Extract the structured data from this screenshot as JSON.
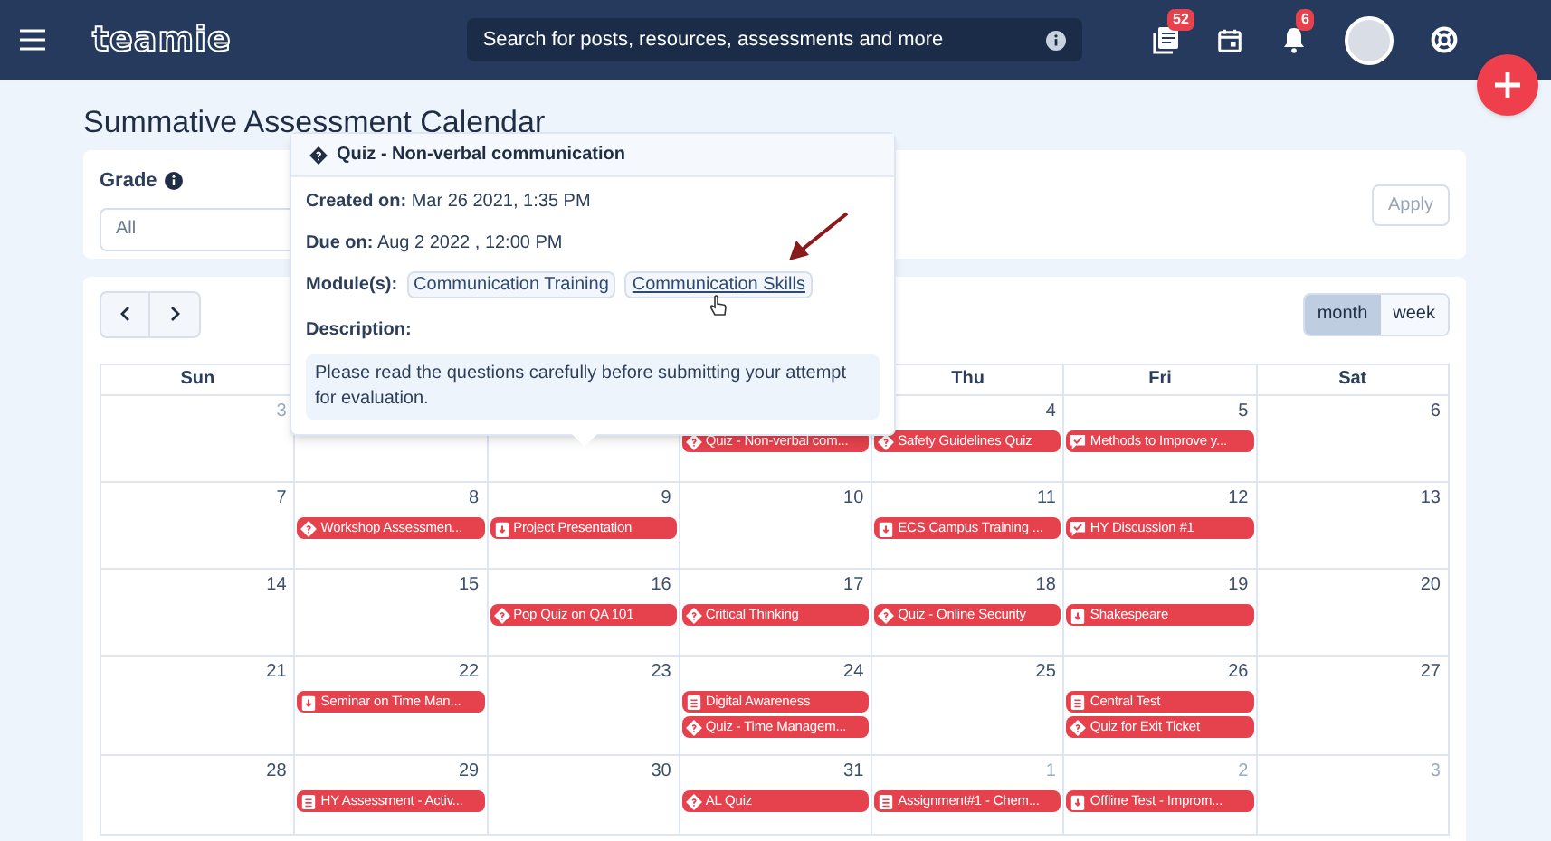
{
  "navbar": {
    "logo": "teamie",
    "search": {
      "placeholder": "Search for posts, resources, assessments and more"
    },
    "badges": [
      {
        "kind": "posts",
        "count": "52"
      },
      {
        "kind": "calendar"
      },
      {
        "kind": "notifications",
        "count": "6"
      }
    ]
  },
  "page_title": "Summative Assessment Calendar",
  "filter": {
    "label": "Grade",
    "select_value": "All",
    "apply": {
      "label": "Apply",
      "disabled": true
    }
  },
  "views": [
    {
      "label": "month",
      "selected": true
    },
    {
      "label": "week",
      "selected": false
    }
  ],
  "weekdays": {
    "left": [
      "Sun"
    ],
    "right": [
      "Thu",
      "Fri",
      "Sat"
    ]
  },
  "weeks": [
    {
      "days_left": [
        {
          "day": "3",
          "muted": true
        }
      ],
      "days_right": [
        {
          "events": [
            {
              "kind": "quiz",
              "title": "Quiz - Non-verbal com..."
            }
          ]
        },
        {
          "day": "4",
          "muted": false,
          "events": [
            {
              "kind": "quiz",
              "title": "Safety Guidelines Quiz"
            }
          ]
        },
        {
          "day": "5",
          "muted": false,
          "events": [
            {
              "kind": "discussion",
              "title": "Methods to Improve y..."
            }
          ]
        },
        {
          "day": "6",
          "muted": false
        }
      ]
    },
    {
      "days": [
        {
          "day": "7",
          "muted": false
        },
        {
          "day": "8",
          "muted": false,
          "events": [
            {
              "kind": "quiz",
              "title": "Workshop Assessmen..."
            }
          ]
        },
        {
          "day": "9",
          "muted": false,
          "events": [
            {
              "kind": "submission",
              "title": "Project Presentation"
            }
          ]
        },
        {
          "day": "10",
          "muted": false
        },
        {
          "day": "11",
          "muted": false,
          "events": [
            {
              "kind": "submission",
              "title": "ECS Campus Training ..."
            }
          ]
        },
        {
          "day": "12",
          "muted": false,
          "events": [
            {
              "kind": "discussion",
              "title": "HY Discussion #1"
            }
          ]
        },
        {
          "day": "13",
          "muted": false
        }
      ]
    },
    {
      "days": [
        {
          "day": "14",
          "muted": false
        },
        {
          "day": "15",
          "muted": false
        },
        {
          "day": "16",
          "muted": false,
          "events": [
            {
              "kind": "quiz",
              "title": "Pop Quiz on QA 101"
            }
          ]
        },
        {
          "day": "17",
          "muted": false,
          "events": [
            {
              "kind": "quiz",
              "title": "Critical Thinking"
            }
          ]
        },
        {
          "day": "18",
          "muted": false,
          "events": [
            {
              "kind": "quiz",
              "title": "Quiz - Online Security"
            }
          ]
        },
        {
          "day": "19",
          "muted": false,
          "events": [
            {
              "kind": "submission",
              "title": "Shakespeare"
            }
          ]
        },
        {
          "day": "20",
          "muted": false
        }
      ]
    },
    {
      "days": [
        {
          "day": "21",
          "muted": false
        },
        {
          "day": "22",
          "muted": false,
          "events": [
            {
              "kind": "submission",
              "title": "Seminar on Time Man..."
            }
          ]
        },
        {
          "day": "23",
          "muted": false
        },
        {
          "day": "24",
          "muted": false,
          "events": [
            {
              "kind": "document",
              "title": "Digital Awareness"
            },
            {
              "kind": "quiz",
              "title": "Quiz - Time Managem..."
            }
          ]
        },
        {
          "day": "25",
          "muted": false
        },
        {
          "day": "26",
          "muted": false,
          "events": [
            {
              "kind": "document",
              "title": "Central Test"
            },
            {
              "kind": "quiz",
              "title": "Quiz for Exit Ticket"
            }
          ]
        },
        {
          "day": "27",
          "muted": false
        }
      ]
    },
    {
      "days": [
        {
          "day": "28",
          "muted": false
        },
        {
          "day": "29",
          "muted": false,
          "events": [
            {
              "kind": "document",
              "title": "HY Assessment - Activ..."
            }
          ]
        },
        {
          "day": "30",
          "muted": false
        },
        {
          "day": "31",
          "muted": false,
          "events": [
            {
              "kind": "quiz",
              "title": "AL Quiz"
            }
          ]
        },
        {
          "day": "1",
          "muted": true,
          "events": [
            {
              "kind": "document",
              "title": "Assignment#1 - Chem..."
            }
          ]
        },
        {
          "day": "2",
          "muted": true,
          "events": [
            {
              "kind": "submission",
              "title": "Offline Test - Improm..."
            }
          ]
        },
        {
          "day": "3",
          "muted": true
        }
      ]
    }
  ],
  "popover": {
    "kind": "quiz",
    "title": "Quiz - Non-verbal communication",
    "created": "**Created on:** Mar 26 2021, 1:35 PM",
    "due": "**Due on:** Aug 2 2022 , 12:00 PM",
    "modules_label": "Module(s):",
    "modules": [
      {
        "label": "Communication Training",
        "hovered": false
      },
      {
        "label": "Communication Skills",
        "hovered": true
      }
    ],
    "description_label": "Description:",
    "description": "Please read the questions carefully before submitting your attempt for evaluation."
  }
}
